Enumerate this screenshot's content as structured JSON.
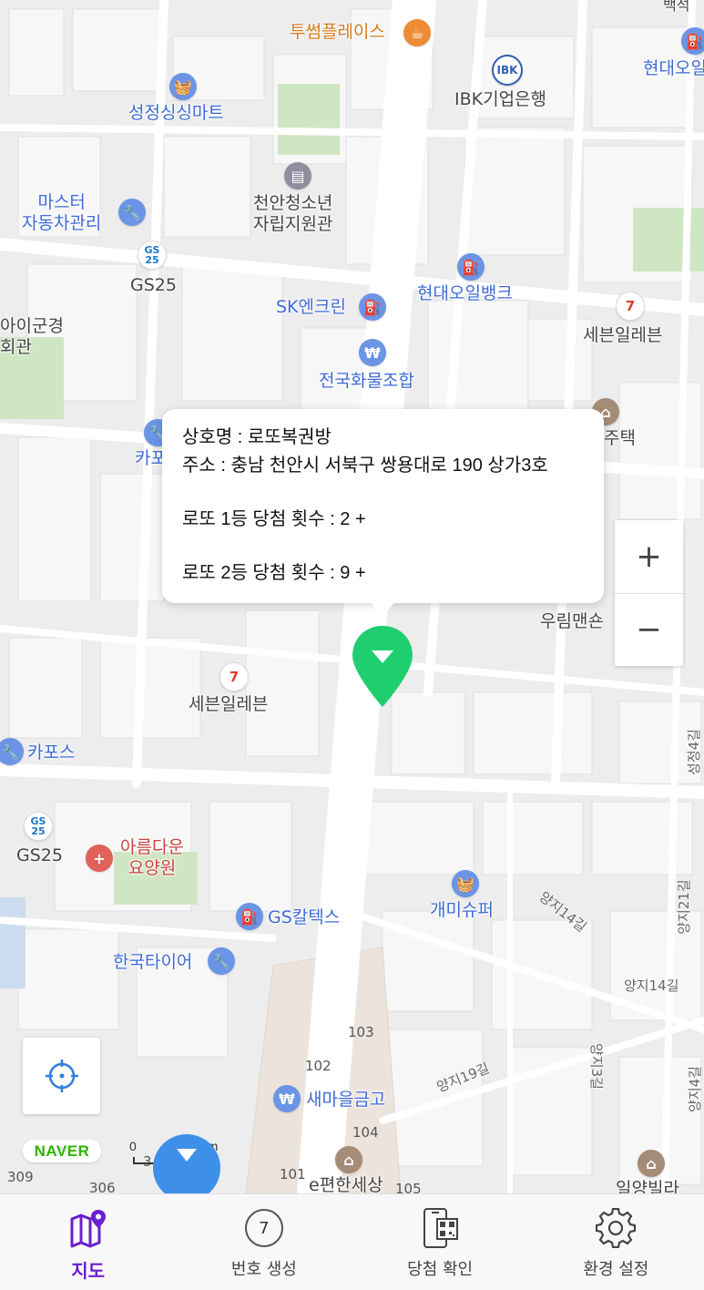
{
  "map": {
    "pois": [
      {
        "id": "toosome",
        "label": "투썸플레이스",
        "color": "orange"
      },
      {
        "id": "ibk",
        "label": "IBK기업은행",
        "color": "gray"
      },
      {
        "id": "hyundai-oil-top",
        "label": "현대오일",
        "color": "blue"
      },
      {
        "id": "seongjeong-mart",
        "label": "성정싱싱마트",
        "color": "blue"
      },
      {
        "id": "master-auto",
        "label": "마스터\n자동차관리",
        "color": "blue"
      },
      {
        "id": "youth-center",
        "label": "천안청소년\n자립지원관",
        "color": "gray"
      },
      {
        "id": "gs25-top",
        "label": "GS25",
        "color": "gray"
      },
      {
        "id": "sk-enclean",
        "label": "SK엔크린",
        "color": "blue"
      },
      {
        "id": "hyundai-oilbank",
        "label": "현대오일뱅크",
        "color": "blue"
      },
      {
        "id": "seven-top",
        "label": "세븐일레븐",
        "color": "gray"
      },
      {
        "id": "police-left",
        "label": "아이군경\n회관",
        "color": "gray"
      },
      {
        "id": "cargo-union",
        "label": "전국화물조합",
        "color": "blue"
      },
      {
        "id": "jutaek",
        "label": "주택",
        "color": "gray"
      },
      {
        "id": "ka-left",
        "label": "카포",
        "color": "blue"
      },
      {
        "id": "woorim",
        "label": "우림맨숀",
        "color": "gray"
      },
      {
        "id": "seven-mid",
        "label": "세븐일레븐",
        "color": "gray"
      },
      {
        "id": "kapos",
        "label": "카포스",
        "color": "blue"
      },
      {
        "id": "gs25-mid",
        "label": "GS25",
        "color": "gray"
      },
      {
        "id": "nursing",
        "label": "아름다운\n요양원",
        "color": "red"
      },
      {
        "id": "gaemi",
        "label": "개미슈퍼",
        "color": "blue"
      },
      {
        "id": "gs-caltex",
        "label": "GS칼텍스",
        "color": "blue"
      },
      {
        "id": "hankook",
        "label": "한국타이어",
        "color": "blue"
      },
      {
        "id": "saemaul",
        "label": "새마을금고",
        "color": "blue"
      },
      {
        "id": "epyeonhan",
        "label": "e편한세상",
        "color": "gray"
      },
      {
        "id": "iyang",
        "label": "일양빌라",
        "color": "gray"
      },
      {
        "id": "baekseok",
        "label": "백석",
        "color": "gray"
      }
    ],
    "streets": [
      "양지14길",
      "양지14길",
      "양지19길",
      "양지21길",
      "양지3길",
      "양지4길",
      "성정4길"
    ],
    "buildings": [
      "103",
      "102",
      "104",
      "101",
      "105",
      "309",
      "306",
      "3"
    ],
    "scale": {
      "zero": "0",
      "distance": "50m"
    },
    "naver_logo": "NAVER"
  },
  "popup": {
    "name_line": "상호명 : 로또복권방",
    "address_line": "주소 : 충남 천안시 서북구 쌍용대로 190 상가3호",
    "first_prize_line": "로또 1등 당첨 횟수 :  2 +",
    "second_prize_line": "로또 2등 당첨 횟수 :  9 +"
  },
  "zoom": {
    "in": "+",
    "out": "−"
  },
  "navbar": {
    "items": [
      {
        "label": "지도",
        "icon": "map-pin-icon",
        "active": true
      },
      {
        "label": "번호 생성",
        "icon": "lotto-ball-icon",
        "badge": "7",
        "active": false
      },
      {
        "label": "당첨 확인",
        "icon": "qr-scan-icon",
        "active": false
      },
      {
        "label": "환경 설정",
        "icon": "gear-icon",
        "active": false
      }
    ]
  },
  "colors": {
    "pin": "#1fcf6f",
    "active_nav": "#6a1fd0",
    "poi_blue": "#3e6bd8",
    "fab": "#3e8fe8",
    "park": "#cfe6c4"
  }
}
